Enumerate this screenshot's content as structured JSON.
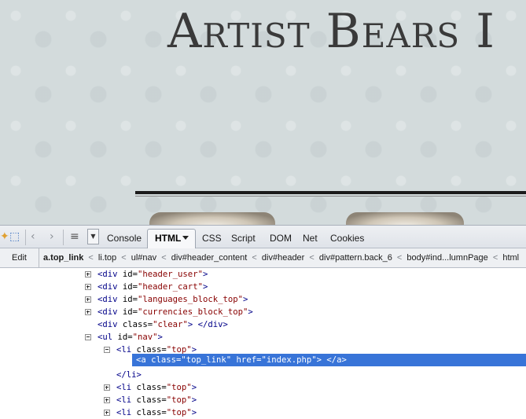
{
  "website": {
    "title": "Artist Bears I"
  },
  "toolbar": {
    "icons": [
      "inspect-element-icon",
      "back-icon",
      "forward-icon",
      "command-line-icon"
    ],
    "tabs": {
      "console": "Console",
      "html": "HTML",
      "css": "CSS",
      "script": "Script",
      "dom": "DOM",
      "net": "Net",
      "cookies": "Cookies"
    }
  },
  "breadcrumb": {
    "edit": "Edit",
    "items": [
      "a.top_link",
      "li.top",
      "ul#nav",
      "div#header_content",
      "div#header",
      "div#pattern.back_6",
      "body#ind...lumnPage",
      "html"
    ],
    "separator": "<"
  },
  "tree": {
    "rows": [
      {
        "twisty": "plus",
        "open": "<div",
        "attr": " id=",
        "val": "\"header_user\"",
        "close": ">"
      },
      {
        "twisty": "plus",
        "open": "<div",
        "attr": " id=",
        "val": "\"header_cart\"",
        "close": ">"
      },
      {
        "twisty": "plus",
        "open": "<div",
        "attr": " id=",
        "val": "\"languages_block_top\"",
        "close": ">"
      },
      {
        "twisty": "plus",
        "open": "<div",
        "attr": " id=",
        "val": "\"currencies_block_top\"",
        "close": ">"
      },
      {
        "twisty": "none",
        "open": "<div",
        "attr": " class=",
        "val": "\"clear\"",
        "close": "> </div>"
      },
      {
        "twisty": "minus",
        "open": "<ul",
        "attr": " id=",
        "val": "\"nav\"",
        "close": ">"
      },
      {
        "twisty": "minus",
        "open": "<li",
        "attr": " class=",
        "val": "\"top\"",
        "close": ">"
      },
      {
        "twisty": "none",
        "text": "<a class=\"top_link\" href=\"index.php\"> </a>"
      },
      {
        "twisty": "none",
        "open": "</li>",
        "attr": "",
        "val": "",
        "close": ""
      },
      {
        "twisty": "plus",
        "open": "<li",
        "attr": " class=",
        "val": "\"top\"",
        "close": ">"
      },
      {
        "twisty": "plus",
        "open": "<li",
        "attr": " class=",
        "val": "\"top\"",
        "close": ">"
      },
      {
        "twisty": "plus",
        "open": "<li",
        "attr": " class=",
        "val": "\"top\"",
        "close": ">"
      }
    ]
  },
  "colors": {
    "selection": "#3874d8",
    "tag": "#000088",
    "value": "#880000"
  }
}
